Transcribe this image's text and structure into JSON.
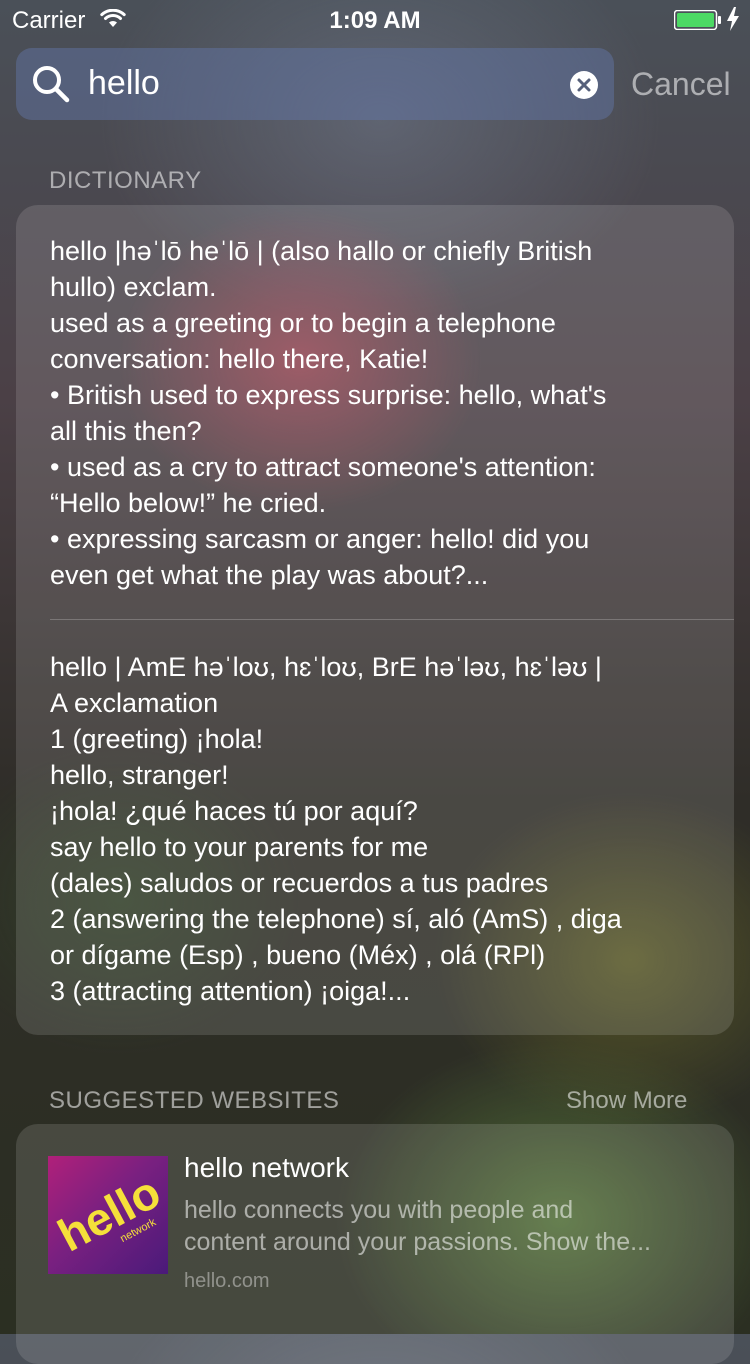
{
  "status_bar": {
    "carrier": "Carrier",
    "time": "1:09 AM",
    "battery_color": "#4cd964"
  },
  "search": {
    "query": "hello",
    "cancel_label": "Cancel"
  },
  "dictionary": {
    "section_title": "DICTIONARY",
    "entries": [
      {
        "lines": [
          "hello |həˈlō heˈlō | (also hallo or chiefly British",
          "hullo) exclam.",
          "used as a greeting or to begin a telephone",
          "conversation: hello there, Katie!",
          "• British used to express surprise: hello, what's",
          "all this then?",
          "• used as a cry to attract someone's attention:",
          "“Hello below!” he cried.",
          "• expressing sarcasm or anger: hello! did you",
          "even get what the play was about?..."
        ]
      },
      {
        "lines": [
          "hello | AmE həˈloʊ, hɛˈloʊ, BrE həˈləʊ, hɛˈləʊ |",
          "A exclamation",
          "1 (greeting) ¡hola!",
          "hello, stranger!",
          "¡hola! ¿qué haces tú por aquí?",
          "say hello to your parents for me",
          "(dales) saludos or recuerdos a tus padres",
          "2 (answering the telephone) sí, aló (AmS) , diga",
          "or dígame (Esp) , bueno (Méx) , olá (RPl)",
          "3 (attracting attention) ¡oiga!..."
        ]
      }
    ]
  },
  "suggested_websites": {
    "section_title": "SUGGESTED WEBSITES",
    "show_more_label": "Show More",
    "items": [
      {
        "logo_text": "hello",
        "logo_subtext": "network",
        "title": "hello network",
        "description_lines": [
          "hello connects you with people and",
          "content around your passions. Show the..."
        ],
        "url": "hello.com"
      }
    ]
  }
}
